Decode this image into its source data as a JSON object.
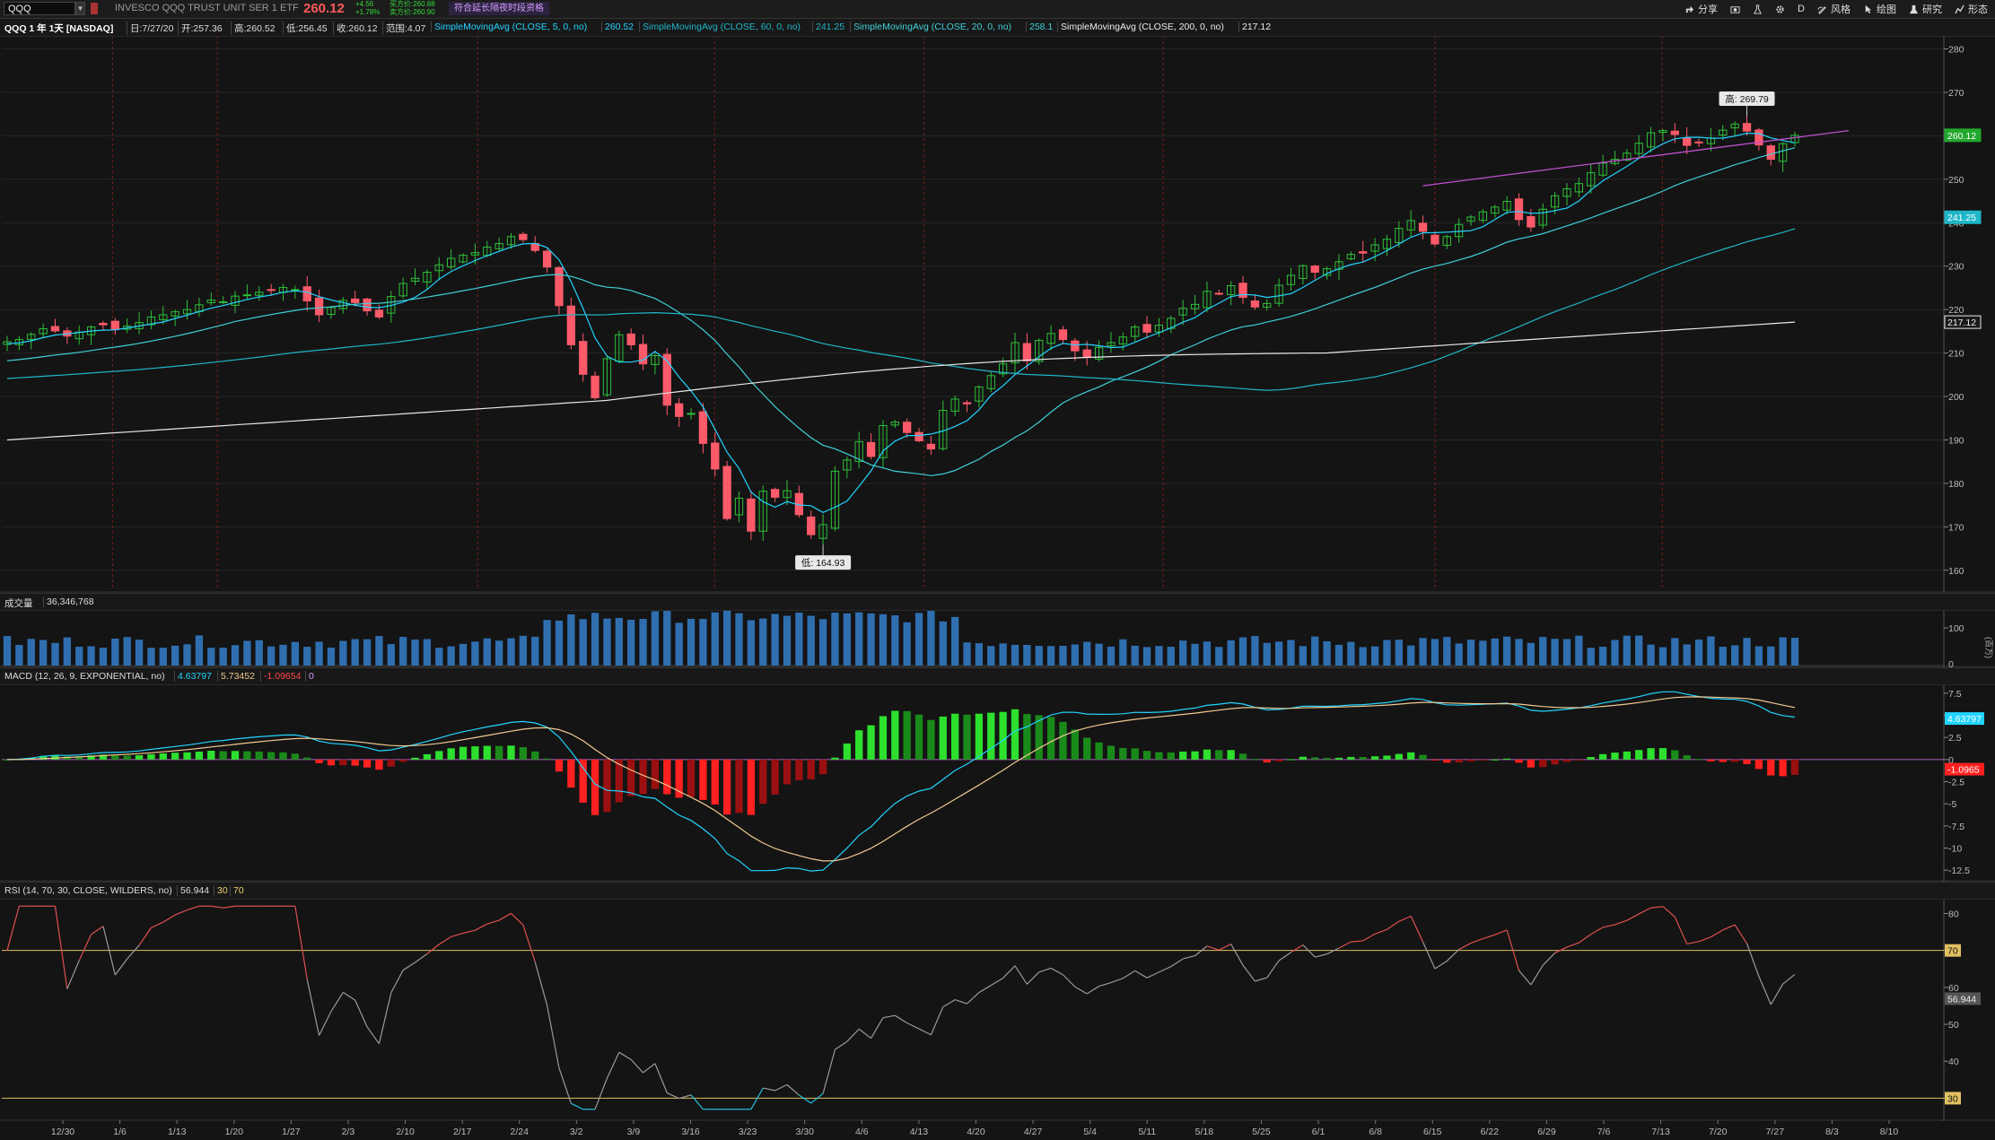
{
  "toolbar": {
    "symbol": "QQQ",
    "description": "INVESCO QQQ TRUST UNIT SER 1 ETF",
    "last": "260.12",
    "change_abs": "+4.56",
    "change_pct": "+1.78%",
    "bid": "买方价:260.88",
    "ask": "卖方价:260.90",
    "ext_hours": "符合延长隔夜时段资格",
    "share_label": "分享",
    "period_label": "D",
    "style_label": "风格",
    "draw_label": "绘图",
    "study_label": "研究",
    "pattern_label": "形态"
  },
  "header": {
    "title": "QQQ 1 年 1天 [NASDAQ]",
    "date": "日:7/27/20",
    "open": "开:257.36",
    "high": "高:260.52",
    "low": "低:256.45",
    "close": "收:260.12",
    "range": "范围:4.07",
    "sma5_label": "SimpleMovingAvg (CLOSE, 5, 0, no)",
    "sma5_val": "260.52",
    "sma60_label": "SimpleMovingAvg (CLOSE, 60, 0, no)",
    "sma60_val": "241.25",
    "sma20_label": "SimpleMovingAvg (CLOSE, 20, 0, no)",
    "sma20_val": "258.1",
    "sma200_label": "SimpleMovingAvg (CLOSE, 200, 0, no)",
    "sma200_val": "217.12"
  },
  "volume_panel": {
    "label": "成交量",
    "value": "36,346,768",
    "unit": "(百万)",
    "ticks": [
      "100",
      "0"
    ]
  },
  "macd_panel": {
    "label": "MACD (12, 26, 9, EXPONENTIAL, no)",
    "v1": "4.63797",
    "v2": "5.73452",
    "v3": "-1.09654",
    "v4": "0",
    "tag_value": "4.63797",
    "tag_diff": "-1.0965"
  },
  "rsi_panel": {
    "label": "RSI (14, 70, 30, CLOSE, WILDERS, no)",
    "v1": "56.944",
    "v2": "30",
    "v3": "70",
    "tag_value": "56.944",
    "ticks": [
      "80",
      "70",
      "60",
      "50",
      "40",
      "30"
    ]
  },
  "chart_data": {
    "type": "candlestick",
    "price_ticks": [
      280,
      270,
      260,
      250,
      240,
      230,
      220,
      210,
      200,
      190,
      180,
      170,
      160
    ],
    "price_range": [
      155,
      283
    ],
    "high_callout": "高: 269.79",
    "low_callout": "低: 164.93",
    "price_tags": [
      {
        "label": "260.12",
        "value": 260.12,
        "color": "#22a82e"
      },
      {
        "label": "241.25",
        "value": 241.25,
        "color": "#1fb6c8"
      },
      {
        "label": "217.12",
        "value": 217.12,
        "color": "#e8e8e8"
      }
    ],
    "x_labels": [
      "12/30",
      "1/6",
      "1/13",
      "1/20",
      "1/27",
      "2/3",
      "2/10",
      "2/17",
      "2/24",
      "3/2",
      "3/9",
      "3/16",
      "3/23",
      "3/30",
      "4/6",
      "4/13",
      "4/20",
      "4/27",
      "5/4",
      "5/11",
      "5/18",
      "5/25",
      "6/1",
      "6/8",
      "6/15",
      "6/22",
      "6/29",
      "7/6",
      "7/13",
      "7/20",
      "7/27",
      "8/3",
      "8/10"
    ],
    "macd_ticks": [
      "7.5",
      "5",
      "2.5",
      "0",
      "-2.5",
      "-5",
      "-7.5",
      "-10",
      "-12.5"
    ],
    "closes": [
      212.6,
      213.1,
      214.3,
      215.6,
      215.1,
      213.9,
      214.8,
      216.0,
      216.5,
      215.4,
      216.2,
      217.0,
      218.3,
      218.8,
      219.5,
      220.0,
      221.1,
      222.2,
      221.8,
      223.1,
      223.4,
      224.0,
      224.4,
      225.1,
      224.6,
      222.0,
      218.8,
      220.5,
      222.1,
      221.6,
      219.7,
      218.3,
      223.0,
      226.0,
      227.2,
      228.6,
      230.3,
      231.8,
      232.5,
      233.1,
      234.4,
      235.2,
      236.8,
      236.1,
      233.6,
      229.8,
      220.9,
      211.9,
      205.1,
      199.7,
      208.7,
      214.2,
      211.9,
      207.5,
      209.4,
      198.0,
      195.4,
      196.1,
      189.2,
      183.3,
      171.9,
      176.6,
      169.0,
      178.2,
      176.8,
      178.3,
      172.8,
      168.2,
      170.5,
      182.8,
      185.4,
      189.6,
      186.2,
      193.3,
      194.1,
      191.7,
      189.8,
      187.9,
      196.8,
      199.4,
      198.3,
      202.2,
      204.8,
      207.5,
      212.4,
      208.2,
      212.9,
      214.5,
      213.1,
      210.5,
      209.0,
      211.3,
      212.4,
      213.7,
      216.0,
      214.8,
      216.4,
      218.0,
      220.3,
      221.2,
      224.2,
      223.7,
      225.5,
      222.8,
      220.6,
      221.4,
      225.6,
      227.9,
      230.1,
      228.6,
      229.4,
      231.0,
      232.7,
      233.0,
      234.9,
      236.2,
      238.7,
      240.5,
      238.0,
      235.1,
      236.8,
      239.6,
      241.3,
      242.5,
      243.6,
      244.9,
      240.7,
      239.0,
      243.1,
      246.2,
      247.8,
      249.0,
      251.5,
      253.7,
      254.6,
      256.0,
      258.3,
      260.7,
      261.2,
      260.3,
      257.8,
      258.4,
      259.5,
      261.3,
      262.7,
      261.1,
      257.9,
      254.6,
      258.2,
      260.12
    ]
  }
}
